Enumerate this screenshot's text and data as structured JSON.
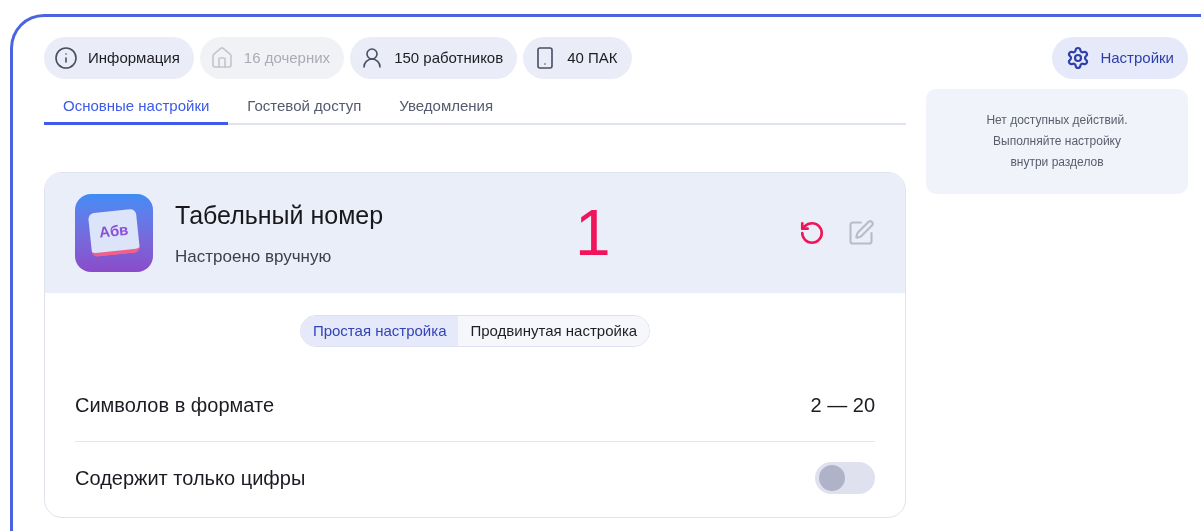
{
  "chips": [
    {
      "kind": "info",
      "label": "Информация",
      "disabled": false
    },
    {
      "kind": "house",
      "label": "16 дочерних",
      "disabled": true
    },
    {
      "kind": "person",
      "label": "150 работников",
      "disabled": false
    },
    {
      "kind": "phone",
      "label": "40 ПАК",
      "disabled": false
    }
  ],
  "settings_button": {
    "label": "Настройки"
  },
  "tabs": [
    {
      "label": "Основные настройки",
      "selected": true
    },
    {
      "label": "Гостевой доступ",
      "selected": false
    },
    {
      "label": "Уведомления",
      "selected": false
    }
  ],
  "actions_note": {
    "lines": [
      "Нет доступных действий.",
      "Выполняйте настройку",
      "внутри разделов"
    ]
  },
  "card": {
    "app_icon_text": "Абв",
    "title": "Табельный номер",
    "subtitle": "Настроено вручную",
    "annotation": "1",
    "mode_tabs": [
      {
        "label": "Простая настройка",
        "selected": true
      },
      {
        "label": "Продвинутая настройка",
        "selected": false
      }
    ],
    "rows": [
      {
        "kind": "value",
        "label": "Символов в формате",
        "value": "2 — 20"
      },
      {
        "kind": "toggle",
        "label": "Содержит только цифры",
        "on": false
      }
    ]
  }
}
